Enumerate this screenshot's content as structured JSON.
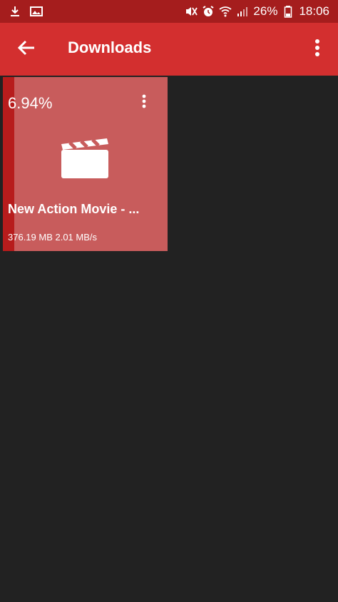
{
  "status_bar": {
    "battery": "26%",
    "time": "18:06",
    "icons_left": [
      "download-icon",
      "image-icon"
    ],
    "icons_right": [
      "mute-icon",
      "alarm-icon",
      "wifi-icon",
      "signal-icon",
      "battery-icon"
    ]
  },
  "app_bar": {
    "title": "Downloads",
    "back_icon": "arrow-left-icon",
    "menu_icon": "more-vert-icon"
  },
  "downloads": [
    {
      "percent_label": "6.94%",
      "progress": 0.0694,
      "name": "New Action Movie - ...",
      "info": "376.19 MB 2.01 MB/s",
      "thumbnail_icon": "movie-clapper-icon",
      "menu_icon": "more-vert-icon"
    }
  ],
  "colors": {
    "status_bar": "#a51d1d",
    "app_bar": "#d32f2f",
    "background": "#222222",
    "card": "#c85c5c",
    "progress": "#b71c1c",
    "text": "#ffffff"
  }
}
